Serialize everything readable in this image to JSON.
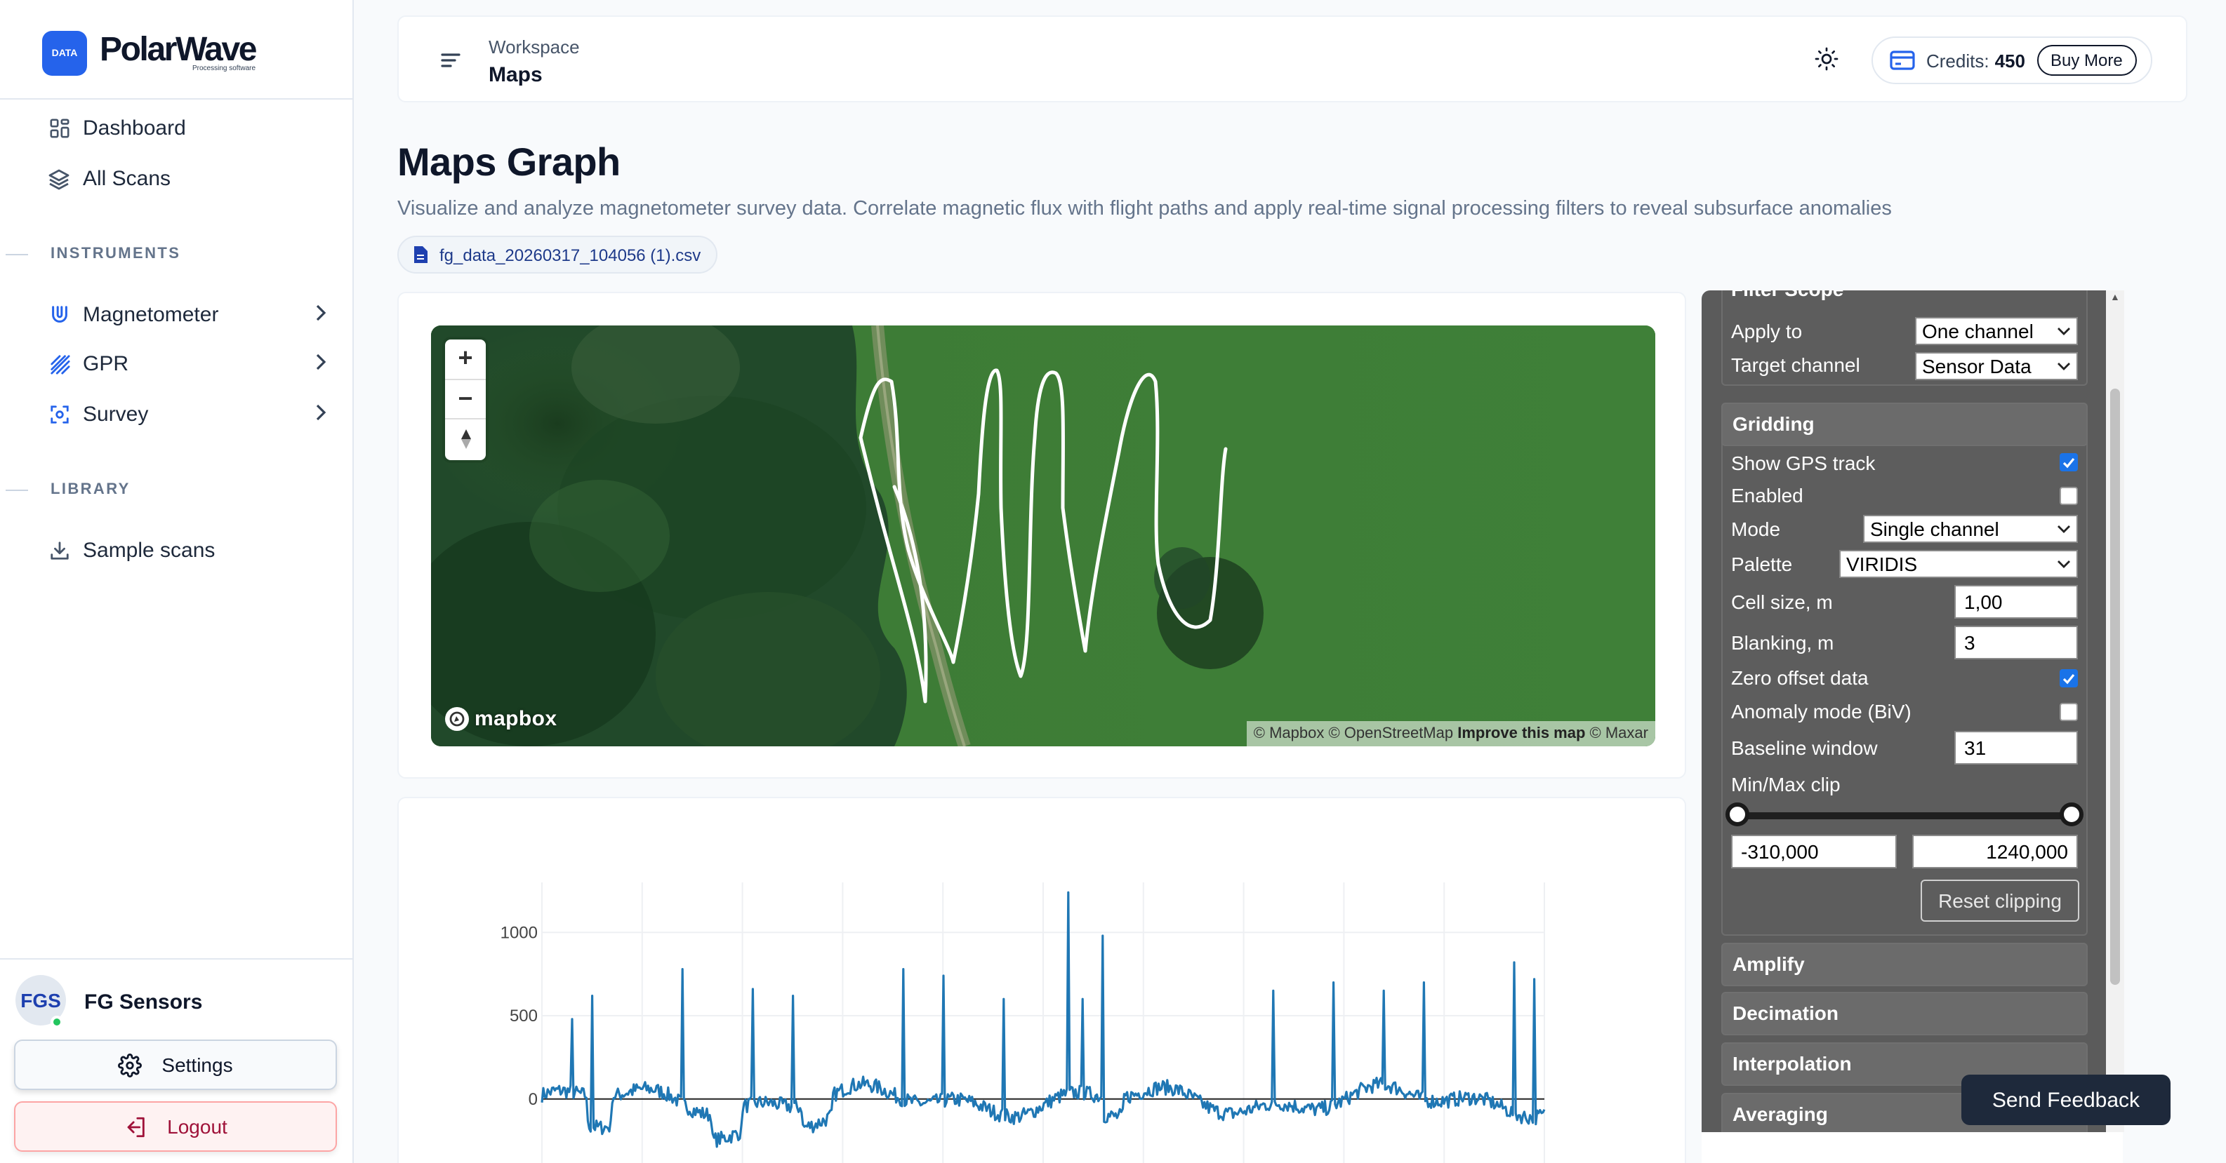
{
  "app": {
    "logo_badge": "DATA",
    "name": "PolarWave",
    "tagline": "Processing software"
  },
  "sidebar": {
    "items": [
      {
        "label": "Dashboard",
        "icon": "grid-icon"
      },
      {
        "label": "All Scans",
        "icon": "layers-icon"
      }
    ],
    "sections": [
      {
        "title": "INSTRUMENTS",
        "items": [
          {
            "label": "Magnetometer",
            "icon": "magnet-icon"
          },
          {
            "label": "GPR",
            "icon": "gpr-icon"
          },
          {
            "label": "Survey",
            "icon": "scan-icon"
          }
        ]
      },
      {
        "title": "LIBRARY",
        "items": [
          {
            "label": "Sample scans",
            "icon": "download-icon"
          }
        ]
      }
    ],
    "user": {
      "initials": "FGS",
      "name": "FG Sensors",
      "status_color": "#22c55e"
    },
    "settings_label": "Settings",
    "logout_label": "Logout"
  },
  "header": {
    "breadcrumb_parent": "Workspace",
    "breadcrumb_current": "Maps",
    "credits_label": "Credits:",
    "credits_value": "450",
    "buy_label": "Buy More"
  },
  "page": {
    "title": "Maps Graph",
    "description": "Visualize and analyze magnetometer survey data. Correlate magnetic flux with flight paths and apply real-time signal processing filters to reveal subsurface anomalies",
    "file_name": "fg_data_20260317_104056 (1).csv"
  },
  "map": {
    "logo_text": "mapbox",
    "attribution": [
      "© Mapbox",
      "© OpenStreetMap",
      "Improve this map",
      "© Maxar"
    ]
  },
  "chart_data": {
    "type": "line",
    "title": "",
    "xlabel": "",
    "ylabel": "",
    "ylim": [
      -300,
      1300
    ],
    "yticks": [
      0,
      500,
      1000
    ],
    "baseline_color": "#1f77b4",
    "spikes": [
      {
        "x": 0.03,
        "y": 480
      },
      {
        "x": 0.05,
        "y": 620
      },
      {
        "x": 0.14,
        "y": 780
      },
      {
        "x": 0.21,
        "y": 660
      },
      {
        "x": 0.25,
        "y": 620
      },
      {
        "x": 0.36,
        "y": 780
      },
      {
        "x": 0.4,
        "y": 740
      },
      {
        "x": 0.46,
        "y": 600
      },
      {
        "x": 0.525,
        "y": 1240
      },
      {
        "x": 0.54,
        "y": 600
      },
      {
        "x": 0.56,
        "y": 980
      },
      {
        "x": 0.73,
        "y": 650
      },
      {
        "x": 0.79,
        "y": 700
      },
      {
        "x": 0.84,
        "y": 650
      },
      {
        "x": 0.88,
        "y": 700
      },
      {
        "x": 0.97,
        "y": 820
      },
      {
        "x": 0.99,
        "y": 720
      }
    ],
    "legend": "none",
    "grid": true
  },
  "filter_panel": {
    "scope_title": "Filter Scope",
    "apply_to_label": "Apply to",
    "apply_to_value": "One channel",
    "target_label": "Target channel",
    "target_value": "Sensor Data",
    "gridding": {
      "title": "Gridding",
      "show_gps_label": "Show GPS track",
      "show_gps": true,
      "enabled_label": "Enabled",
      "enabled": false,
      "mode_label": "Mode",
      "mode_value": "Single channel",
      "palette_label": "Palette",
      "palette_value": "VIRIDIS",
      "cell_label": "Cell size, m",
      "cell_value": "1,00",
      "blanking_label": "Blanking, m",
      "blanking_value": "3",
      "zero_offset_label": "Zero offset data",
      "zero_offset": true,
      "anomaly_label": "Anomaly mode (BiV)",
      "anomaly": false,
      "baseline_label": "Baseline window",
      "baseline_value": "31",
      "clip_label": "Min/Max clip",
      "clip_min": "-310,000",
      "clip_max": "1240,000",
      "reset_label": "Reset clipping"
    },
    "collapsed_groups": [
      "Amplify",
      "Decimation",
      "Interpolation",
      "Averaging"
    ]
  },
  "feedback_label": "Send Feedback",
  "colors": {
    "accent": "#2563eb",
    "panel": "#5b5b5b",
    "checkbox": "#1a73e8",
    "line": "#1f77b4"
  }
}
